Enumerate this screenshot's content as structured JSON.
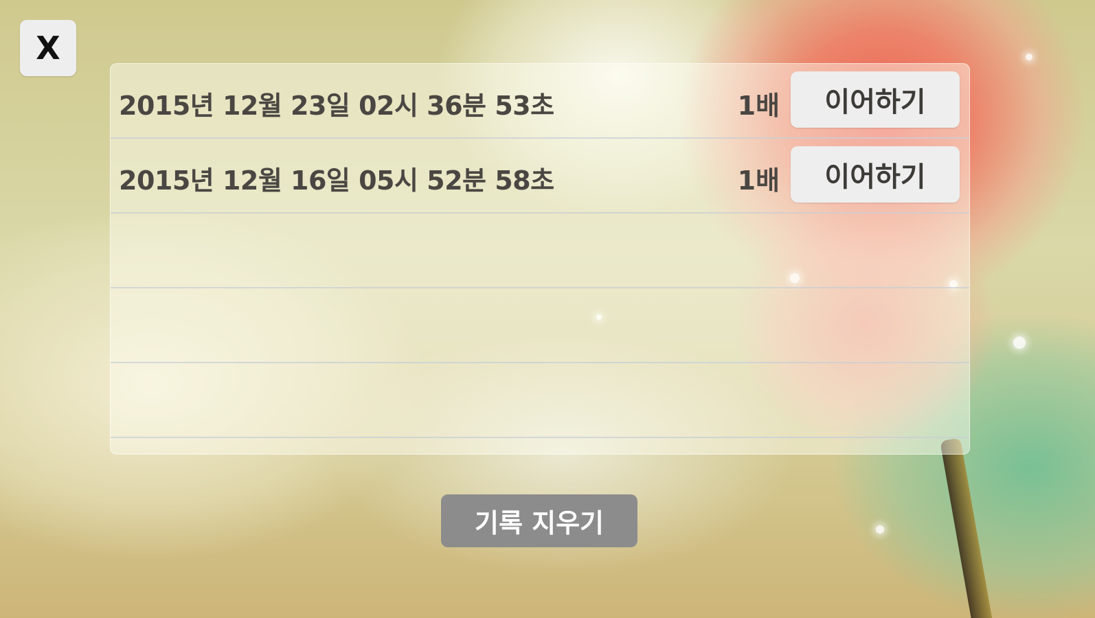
{
  "close_button": {
    "label": "X"
  },
  "history": {
    "rows": [
      {
        "date": "2015년 12월 23일 02시 36분 53초",
        "speed": "1배",
        "action": "이어하기"
      },
      {
        "date": "2015년 12월 16일 05시 52분 58초",
        "speed": "1배",
        "action": "이어하기"
      },
      {
        "date": "",
        "speed": "",
        "action": ""
      },
      {
        "date": "",
        "speed": "",
        "action": ""
      },
      {
        "date": "",
        "speed": "",
        "action": ""
      }
    ]
  },
  "clear_button": {
    "label": "기록 지우기"
  },
  "colors": {
    "panel_background": "#fffff5",
    "button_background": "#eeeeee",
    "clear_button_background": "#8c8c8c",
    "text": "#4a4642"
  }
}
